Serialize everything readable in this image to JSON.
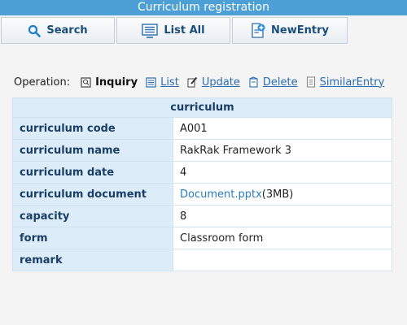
{
  "window": {
    "title": "Curriculum registration"
  },
  "toolbar": {
    "search_label": "Search",
    "list_label": "List All",
    "new_label": "NewEntry"
  },
  "operation": {
    "label": "Operation:",
    "current": "Inquiry",
    "links": [
      "List",
      "Update",
      "Delete",
      "SimilarEntry"
    ]
  },
  "detail": {
    "header": "curriculum",
    "rows": [
      {
        "label": "curriculum code",
        "value": "A001"
      },
      {
        "label": "curriculum name",
        "value": "RakRak Framework 3"
      },
      {
        "label": "curriculum date",
        "value": "4"
      },
      {
        "label": "curriculum document",
        "value": "Document.pptx",
        "suffix": "(3MB)"
      },
      {
        "label": "capacity",
        "value": "8"
      },
      {
        "label": "form",
        "value": "Classroom form"
      },
      {
        "label": "remark",
        "value": ""
      }
    ]
  },
  "colors": {
    "title_bar": "#4da0d6",
    "label_cell": "#dcecf8",
    "link": "#2a6db0"
  }
}
